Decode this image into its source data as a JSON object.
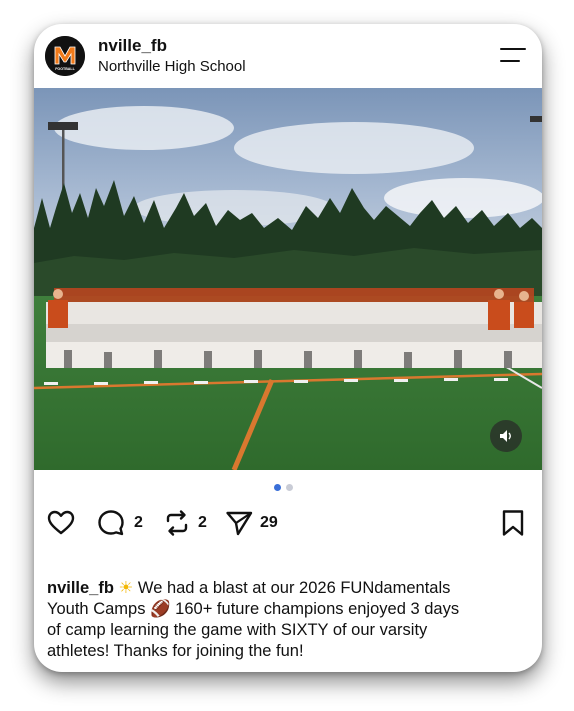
{
  "post": {
    "username": "nville_fb",
    "location": "Northville High School",
    "avatar_letter": "N",
    "avatar_text": "FOOTBALL",
    "caption_lines": [
      " We had a blast at our 2026 FUNdamentals",
      "Youth Camps ",
      "  160+ future champions enjoyed 3 days",
      "of camp learning the game with SIXTY of our varsity",
      "athletes! Thanks for joining the fun!"
    ],
    "emoji_sun": "☀",
    "emoji_football": "🏈",
    "carousel": {
      "count": 2,
      "active_index": 0
    }
  },
  "actions": {
    "comments": "2",
    "reposts": "2",
    "shares": "29"
  },
  "colors": {
    "accent_blue": "#3a6fd8",
    "inactive_dot": "#c9ccd6",
    "text": "#111111",
    "avatar_orange": "#f07a1a"
  }
}
